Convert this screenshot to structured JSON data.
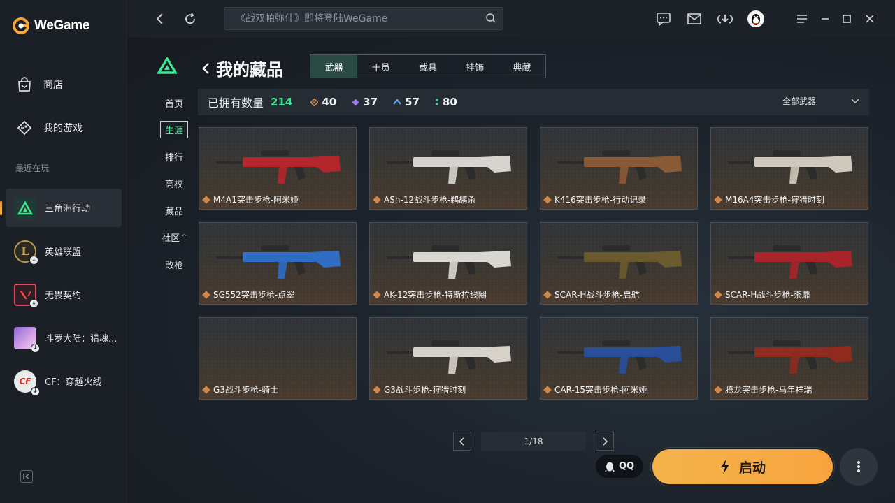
{
  "app": {
    "title": "WeGame"
  },
  "sidebar": {
    "nav": [
      {
        "label": "商店",
        "icon": "shop-bag-icon"
      },
      {
        "label": "我的游戏",
        "icon": "game-controller-icon"
      }
    ],
    "recent_label": "最近在玩",
    "games": [
      {
        "name": "三角洲行动",
        "active": true
      },
      {
        "name": "英雄联盟"
      },
      {
        "name": "无畏契约"
      },
      {
        "name": "斗罗大陆：猎魂..."
      },
      {
        "name": "CF：穿越火线"
      }
    ]
  },
  "topbar": {
    "search_placeholder": "《战双帕弥什》即将登陆WeGame"
  },
  "subnav": [
    "首页",
    "生涯",
    "排行",
    "高校",
    "藏品",
    "社区",
    "改枪"
  ],
  "collection": {
    "title": "我的藏品",
    "tabs": [
      "武器",
      "干员",
      "载具",
      "挂饰",
      "典藏"
    ],
    "owned_label": "已拥有数量",
    "owned_total": "214",
    "stats": [
      {
        "value": "40",
        "color": "#d68a4a"
      },
      {
        "value": "37",
        "color": "#9b7cf0"
      },
      {
        "value": "57",
        "color": "#5ba7f0"
      },
      {
        "value": "80",
        "color": "#3ecf9a"
      }
    ],
    "filter": "全部武器",
    "items": [
      "M4A1突击步枪-阿米娅",
      "ASh-12战斗步枪-鹈鹕杀",
      "K416突击步枪-行动记录",
      "M16A4突击步枪-狩猎时刻",
      "SG552突击步枪-点翠",
      "AK-12突击步枪-特斯拉线圈",
      "SCAR-H战斗步枪-启航",
      "SCAR-H战斗步枪-荼蘼",
      "G3战斗步枪-骑士",
      "G3战斗步枪-狩猎时刻",
      "CAR-15突击步枪-阿米娅",
      "腾龙突击步枪-马年祥瑞"
    ],
    "page": "1/18"
  },
  "actions": {
    "qq_label": "QQ",
    "launch_label": "启动"
  }
}
